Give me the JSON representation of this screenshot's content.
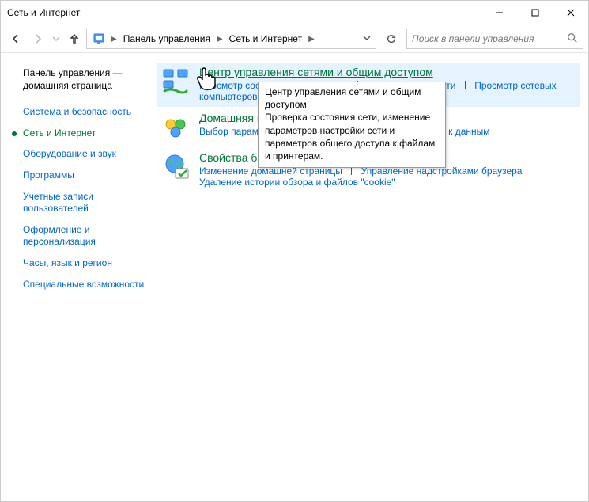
{
  "window": {
    "title": "Сеть и Интернет"
  },
  "breadcrumb": {
    "root": "Панель управления",
    "current": "Сеть и Интернет"
  },
  "search": {
    "placeholder": "Поиск в панели управления"
  },
  "sidebar": {
    "home": "Панель управления — домашняя страница",
    "items": [
      "Система и безопасность",
      "Сеть и Интернет",
      "Оборудование и звук",
      "Программы",
      "Учетные записи пользователей",
      "Оформление и персонализация",
      "Часы, язык и регион",
      "Специальные возможности"
    ]
  },
  "categories": [
    {
      "title": "Центр управления сетями и общим доступом",
      "links": [
        "Просмотр состояния сети и задач",
        "Подключение к сети",
        "Просмотр сетевых компьютеров и устройств"
      ]
    },
    {
      "title": "Домашняя группа",
      "links": [
        "Выбор параметров домашней группы и общего доступа к данным"
      ]
    },
    {
      "title": "Свойства браузера",
      "links": [
        "Изменение домашней страницы",
        "Управление надстройками браузера",
        "Удаление истории обзора и файлов \"cookie\""
      ]
    }
  ],
  "tooltip": {
    "text": "Центр управления сетями и общим доступом\nПроверка состояния сети, изменение параметров настройки сети и параметров общего доступа к файлам и принтерам."
  }
}
